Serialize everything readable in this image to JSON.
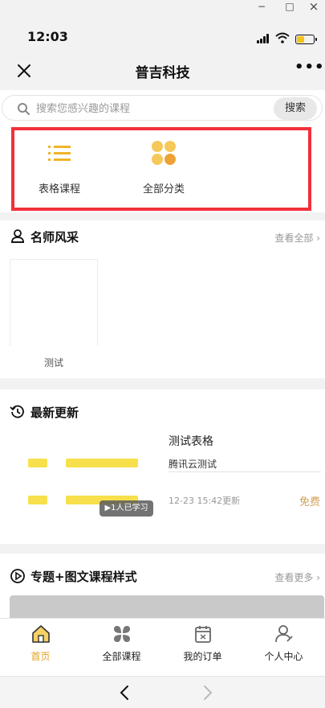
{
  "window": {
    "minimize": "−",
    "maximize": "□",
    "close": "×"
  },
  "status_bar": {
    "time": "12:03",
    "battery_color": "#f5c518"
  },
  "navbar": {
    "title": "普吉科技",
    "close_icon": "close-icon",
    "more": "•••"
  },
  "search": {
    "placeholder": "搜索您感兴趣的课程",
    "button": "搜索"
  },
  "categories": [
    {
      "label": "表格课程",
      "icon": "list-icon"
    },
    {
      "label": "全部分类",
      "icon": "grid-dots-icon"
    }
  ],
  "teachers": {
    "title": "名师风采",
    "more": "查看全部 ›",
    "items": [
      {
        "name": "测试"
      }
    ]
  },
  "latest": {
    "title": "最新更新",
    "course": {
      "title": "测试表格",
      "subtitle": "腾讯云测试",
      "date": "12-23 15:42更新",
      "price": "免费",
      "learners": "▶1人已学习"
    }
  },
  "special": {
    "title": "专题+图文课程样式",
    "more": "查看更多 ›"
  },
  "tabbar": {
    "items": [
      {
        "label": "首页",
        "icon": "home-icon",
        "active": true
      },
      {
        "label": "全部课程",
        "icon": "clover-icon",
        "active": false
      },
      {
        "label": "我的订单",
        "icon": "calendar-icon",
        "active": false
      },
      {
        "label": "个人中心",
        "icon": "user-icon",
        "active": false
      }
    ]
  },
  "colors": {
    "accent": "#f0b429",
    "highlight_border": "#f2303a",
    "free": "#d2a15a"
  }
}
